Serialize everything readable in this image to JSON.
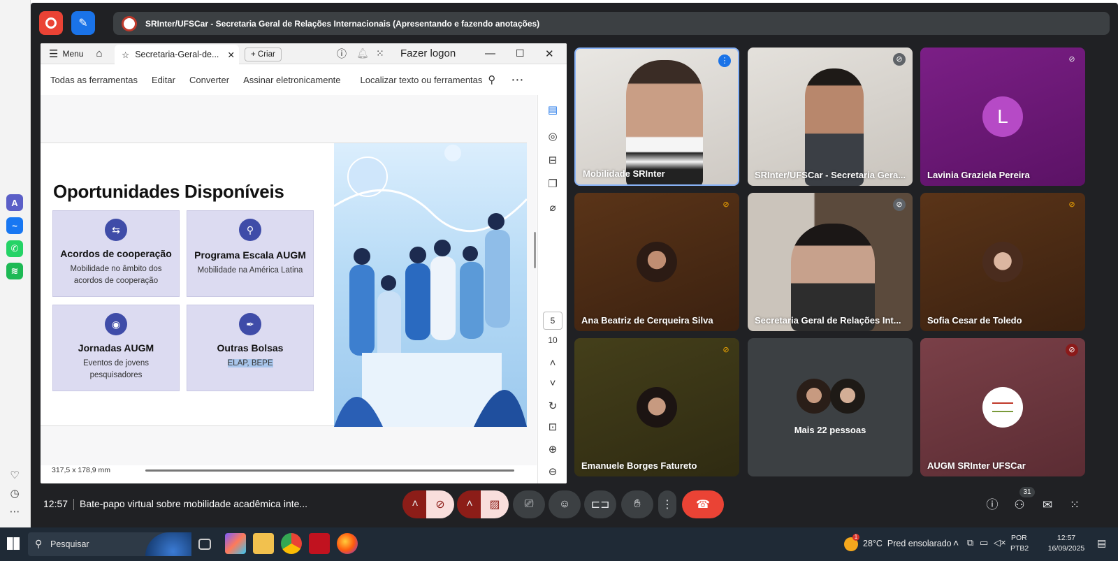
{
  "meeting": {
    "presenting_banner": "SRInter/UFSCar - Secretaria Geral de Relações Internacionais (Apresentando e fazendo anotações)",
    "time": "12:57",
    "meeting_title": "Bate-papo virtual sobre mobilidade acadêmica inte...",
    "participants_badge": "31"
  },
  "pdf": {
    "menu_label": "Menu",
    "tab_title": "Secretaria-Geral-de...",
    "new_button": "Criar",
    "login": "Fazer logon",
    "tools": [
      "Todas as ferramentas",
      "Editar",
      "Converter",
      "Assinar eletronicamente"
    ],
    "search_placeholder": "Localizar texto ou ferramentas",
    "page_current": "5",
    "page_total": "10",
    "page_size": "317,5 x 178,9 mm"
  },
  "slide": {
    "title": "Oportunidades Disponíveis",
    "cards": [
      {
        "title": "Acordos de cooperação",
        "desc": "Mobilidade no âmbito dos acordos de cooperação"
      },
      {
        "title": "Programa Escala AUGM",
        "desc": "Mobilidade na América Latina"
      },
      {
        "title": "Jornadas AUGM",
        "desc": "Eventos de jovens pesquisadores"
      },
      {
        "title": "Outras Bolsas",
        "desc": "ELAP, BEPE"
      }
    ]
  },
  "tiles": [
    {
      "name": "Mobilidade SRInter",
      "muted": false
    },
    {
      "name": "SRInter/UFSCar - Secretaria Gera...",
      "muted": true
    },
    {
      "name": "Lavinia Graziela Pereira",
      "muted": true,
      "initial": "L"
    },
    {
      "name": "Ana Beatriz de Cerqueira Silva",
      "muted": true
    },
    {
      "name": "Secretaria Geral de Relações Int...",
      "muted": true
    },
    {
      "name": "Sofia Cesar de Toledo",
      "muted": true
    },
    {
      "name": "Emanuele Borges Fatureto",
      "muted": true
    },
    {
      "name": "Mais 22 pessoas",
      "muted": false
    },
    {
      "name": "AUGM SRInter UFSCar",
      "muted": true
    }
  ],
  "taskbar": {
    "search": "Pesquisar",
    "weather": "28°C  Pred ensolarado",
    "lang_1": "POR",
    "lang_2": "PTB2",
    "clock_time": "12:57",
    "clock_date": "16/09/2025",
    "weather_badge": "1"
  },
  "colors": {
    "meet_bg": "#202124",
    "end_call": "#ea4335",
    "muted_ctl": "#f9dedc",
    "slide_card": "#dcdbf1",
    "taskbar": "#1f2a36"
  }
}
